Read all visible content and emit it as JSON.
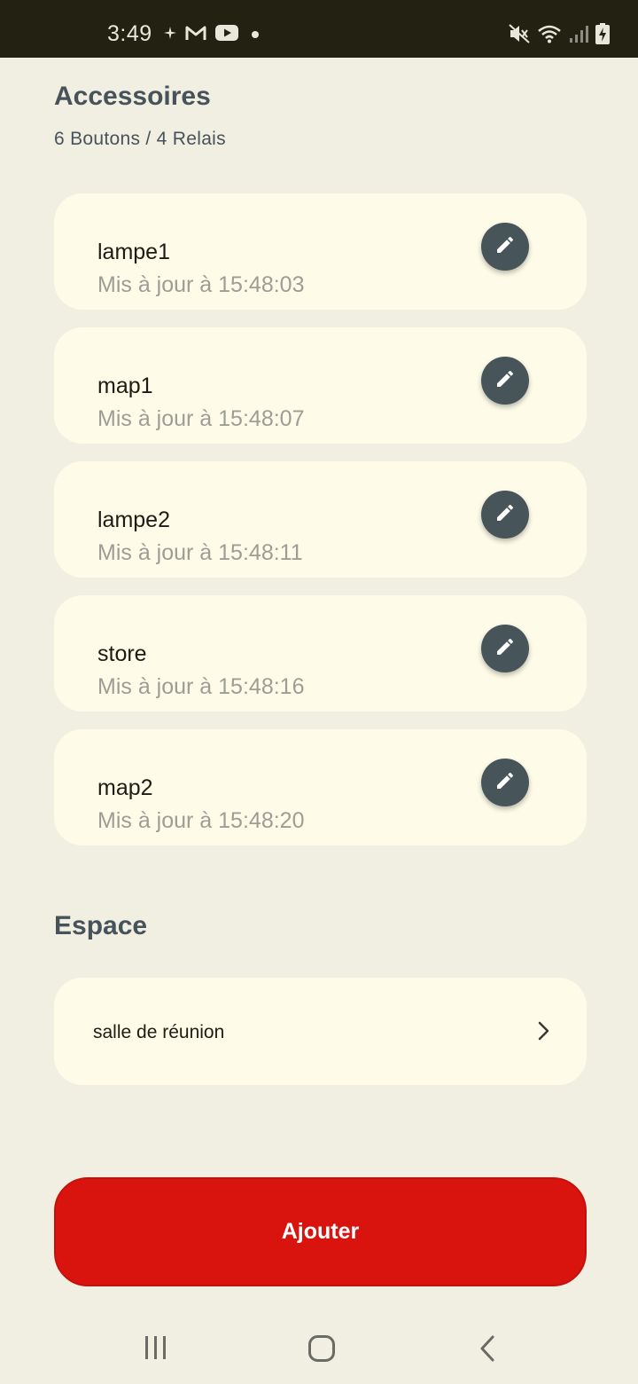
{
  "status_bar": {
    "time": "3:49",
    "left_icons": [
      "sparkle-icon",
      "gmail-icon",
      "youtube-icon",
      "dot-icon"
    ],
    "right_icons": [
      "mute-icon",
      "wifi-icon",
      "signal-icon",
      "battery-charging-icon"
    ]
  },
  "accessories": {
    "title": "Accessoires",
    "subtitle": "6 Boutons / 4 Relais",
    "items": [
      {
        "name": "lampe1",
        "updated": "Mis à jour à 15:48:03"
      },
      {
        "name": "map1",
        "updated": "Mis à jour à 15:48:07"
      },
      {
        "name": "lampe2",
        "updated": "Mis à jour à 15:48:11"
      },
      {
        "name": "store",
        "updated": "Mis à jour à 15:48:16"
      },
      {
        "name": "map2",
        "updated": "Mis à jour à 15:48:20"
      }
    ]
  },
  "space": {
    "title": "Espace",
    "item_label": "salle de réunion"
  },
  "add_button_label": "Ajouter",
  "colors": {
    "background": "#f1efe1",
    "card": "#fefce8",
    "accent_dark": "#47545a",
    "primary_red": "#d9140f",
    "status_bar": "#232111"
  }
}
